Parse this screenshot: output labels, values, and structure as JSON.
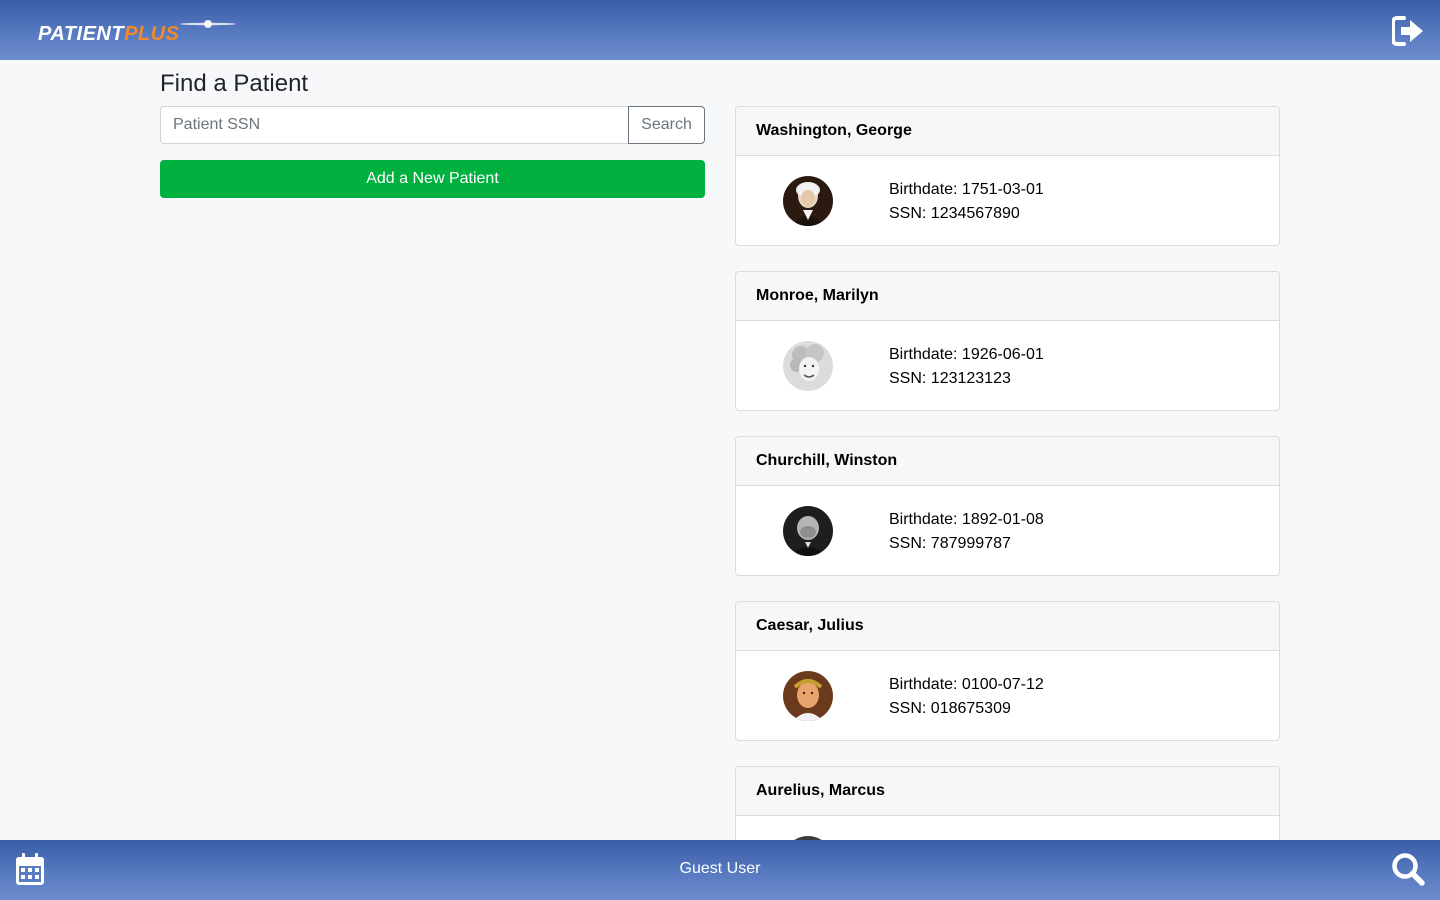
{
  "header": {
    "logo_part1": "PATIENT",
    "logo_part2": "PLUS",
    "logout_icon": "sign-out-icon"
  },
  "search": {
    "title": "Find a Patient",
    "placeholder": "Patient SSN",
    "value": "",
    "search_label": "Search",
    "add_label": "Add a New Patient"
  },
  "patients": [
    {
      "name": "Washington, George",
      "birthdate": "Birthdate: 1751-03-01",
      "ssn": "SSN: 1234567890"
    },
    {
      "name": "Monroe, Marilyn",
      "birthdate": "Birthdate: 1926-06-01",
      "ssn": "SSN: 123123123"
    },
    {
      "name": "Churchill, Winston",
      "birthdate": "Birthdate: 1892-01-08",
      "ssn": "SSN: 787999787"
    },
    {
      "name": "Caesar, Julius",
      "birthdate": "Birthdate: 0100-07-12",
      "ssn": "SSN: 018675309"
    },
    {
      "name": "Aurelius, Marcus",
      "birthdate": "",
      "ssn": ""
    }
  ],
  "footer": {
    "user": "Guest User",
    "calendar_icon": "calendar-icon",
    "search_icon": "search-icon"
  },
  "colors": {
    "bar_top": "#3a5ea9",
    "bar_bottom": "#6d8cce",
    "add_button": "#00b140",
    "logo_accent": "#f08a2b"
  }
}
